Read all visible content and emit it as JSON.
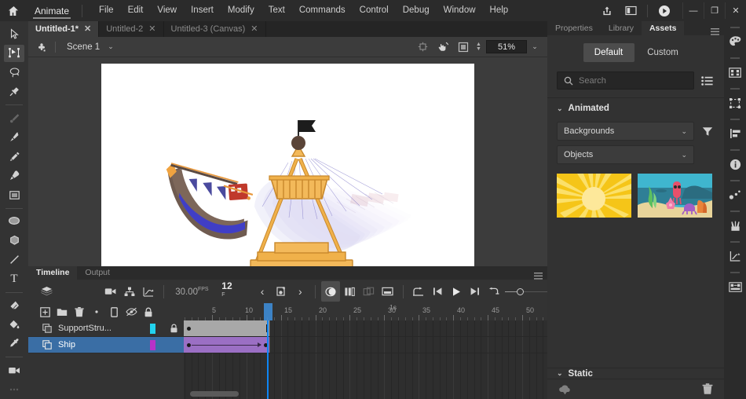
{
  "app": {
    "brand": "Animate",
    "home_icon": "home-icon",
    "menu": [
      "File",
      "Edit",
      "View",
      "Insert",
      "Modify",
      "Text",
      "Commands",
      "Control",
      "Debug",
      "Window",
      "Help"
    ],
    "titlebar_icons": [
      "share-icon",
      "layout-icon",
      "play-preview-icon"
    ],
    "window_controls": {
      "minimize": "—",
      "maximize": "❐",
      "close": "✕"
    }
  },
  "documents": {
    "tabs": [
      {
        "label": "Untitled-1*",
        "close": "✕",
        "active": true
      },
      {
        "label": "Untitled-2",
        "close": "✕",
        "active": false
      },
      {
        "label": "Untitled-3 (Canvas)",
        "close": "✕",
        "active": false
      }
    ]
  },
  "scenebar": {
    "scene_icon": "edit-scene-icon",
    "scene_name": "Scene 1",
    "chevron": "⌄",
    "icons": [
      "clip-content-icon",
      "rotate-canvas-icon",
      "fit-to-stage-icon"
    ],
    "zoom_value": "51%",
    "zoom_chevron": "⌄"
  },
  "toolbar": {
    "tools": [
      {
        "name": "selection-tool",
        "active": false
      },
      {
        "name": "free-transform-tool",
        "active": true
      },
      {
        "name": "lasso-tool",
        "active": false
      },
      {
        "name": "bone-tool",
        "active": false
      },
      {
        "name": "width-tool",
        "active": false,
        "dim": true
      },
      {
        "name": "brush-tool",
        "active": false
      },
      {
        "name": "pencil-tool",
        "active": false
      },
      {
        "name": "pen-tool",
        "active": false
      },
      {
        "name": "rectangle-tool",
        "active": false
      },
      {
        "name": "oval-tool",
        "active": false
      },
      {
        "name": "polystar-tool",
        "active": false
      },
      {
        "name": "line-tool",
        "active": false
      },
      {
        "name": "text-tool",
        "active": false,
        "label": "T"
      },
      {
        "name": "eraser-tool",
        "active": false
      },
      {
        "name": "paint-bucket-tool",
        "active": false
      },
      {
        "name": "eyedropper-tool",
        "active": false
      },
      {
        "name": "camera-tool",
        "active": false
      }
    ]
  },
  "canvas": {
    "artwork_name": "pirate-ship-swing-ride",
    "background": "#ffffff",
    "onion_skin": true
  },
  "timeline": {
    "tabs": [
      {
        "label": "Timeline",
        "active": true
      },
      {
        "label": "Output",
        "active": false
      }
    ],
    "panel_menu": "panel-menu-icon",
    "tools": [
      {
        "name": "layer-depth-icon",
        "active": false
      },
      {
        "name": "add-camera-icon",
        "active": false
      },
      {
        "name": "layer-parenting-icon",
        "active": false
      },
      {
        "name": "motion-editor-icon",
        "active": false
      }
    ],
    "fps": "30.00",
    "fps_suffix": "FPS",
    "current_frame": "12",
    "frame_suffix": "F",
    "playback": [
      {
        "name": "previous-keyframe-button",
        "glyph": "‹"
      },
      {
        "name": "insert-keyframe-button"
      },
      {
        "name": "next-keyframe-button",
        "glyph": "›"
      },
      {
        "name": "onion-skin-button",
        "active": true
      },
      {
        "name": "onion-skin-outlines-button"
      },
      {
        "name": "edit-multiple-frames-button",
        "dim": true
      },
      {
        "name": "modify-onion-markers-button"
      },
      {
        "name": "loop-playback-button"
      },
      {
        "name": "step-back-button"
      },
      {
        "name": "play-button"
      },
      {
        "name": "step-forward-button"
      },
      {
        "name": "loop-range-button"
      }
    ],
    "layer_header_icons": [
      "new-layer-icon",
      "new-folder-icon",
      "delete-layer-icon",
      "dot-icon",
      "show-outlines-icon",
      "hide-layers-icon",
      "lock-layers-icon"
    ],
    "layers": [
      {
        "name": "SupportStru...",
        "color": "#22d3ee",
        "locked": true,
        "selected": false,
        "icon": "layer-icon"
      },
      {
        "name": "Ship",
        "color": "#b832c8",
        "locked": false,
        "selected": true,
        "icon": "layer-icon"
      }
    ],
    "ruler": {
      "ticks": [
        5,
        10,
        15,
        20,
        25,
        30,
        35,
        40,
        45,
        50
      ],
      "second_marker": "1s",
      "second_marker_frame": 30,
      "playhead_frame": 12
    },
    "frames": [
      {
        "layer": "SupportStru...",
        "type": "static",
        "start": 1,
        "end": 13,
        "color": "#a8a8a8",
        "keyframe": 1
      },
      {
        "layer": "Ship",
        "type": "motion-tween",
        "start": 1,
        "end": 13,
        "color": "#9b6fc4",
        "keyframe": 1
      }
    ]
  },
  "rightpanel": {
    "tabs": [
      {
        "label": "Properties",
        "active": false
      },
      {
        "label": "Library",
        "active": false
      },
      {
        "label": "Assets",
        "active": true
      }
    ],
    "panel_menu": "panel-menu-icon",
    "segments": [
      {
        "label": "Default",
        "active": true
      },
      {
        "label": "Custom",
        "active": false
      }
    ],
    "search": {
      "placeholder": "Search",
      "value": "",
      "icon": "search-icon",
      "view_toggle": "list-view-icon"
    },
    "animated": {
      "title": "Animated",
      "chevron": "⌄",
      "dropdowns": [
        {
          "name": "backgrounds-dropdown",
          "value": "Backgrounds",
          "chevron": "⌄"
        },
        {
          "name": "objects-dropdown",
          "value": "Objects",
          "chevron": "⌄"
        }
      ],
      "filter_icon": "filter-icon",
      "thumbnails": [
        {
          "name": "sunburst-background-thumbnail"
        },
        {
          "name": "underwater-scene-thumbnail"
        }
      ]
    },
    "static": {
      "title": "Static",
      "chevron": "⌄"
    },
    "footer": {
      "upload_icon": "upload-asset-icon",
      "delete_icon": "delete-asset-icon"
    }
  },
  "rail": {
    "icons": [
      "color-palette-icon",
      "assets-grid-icon",
      "transform-icon",
      "align-icon",
      "info-icon",
      "motion-presets-icon",
      "tools-icon",
      "graph-icon",
      "library-icon"
    ]
  }
}
